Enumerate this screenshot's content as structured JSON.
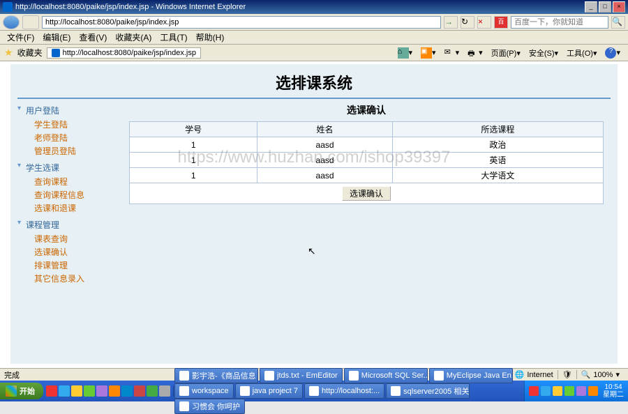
{
  "window": {
    "title": "http://localhost:8080/paike/jsp/index.jsp - Windows Internet Explorer",
    "min": "_",
    "max": "□",
    "close": "×"
  },
  "address": {
    "url": "http://localhost:8080/paike/jsp/index.jsp",
    "search_placeholder": "百度一下，你就知道"
  },
  "menu": {
    "file": "文件(F)",
    "edit": "编辑(E)",
    "view": "查看(V)",
    "favorites": "收藏夹(A)",
    "tools": "工具(T)",
    "help": "帮助(H)"
  },
  "favbar": {
    "label": "收藏夹",
    "tab": "http://localhost:8080/paike/jsp/index.jsp"
  },
  "cmdbar": {
    "page": "页面(P)",
    "safety": "安全(S)",
    "tools": "工具(O)"
  },
  "page": {
    "title": "选排课系统",
    "watermark": "https://www.huzhan.com/ishop39397",
    "panel_title": "选课确认",
    "confirm_btn": "选课确认"
  },
  "sidebar": {
    "groups": [
      {
        "title": "用户登陆",
        "items": [
          "学生登陆",
          "老师登陆",
          "管理员登陆"
        ]
      },
      {
        "title": "学生选课",
        "items": [
          "查询课程",
          "查询课程信息",
          "选课和退课"
        ]
      },
      {
        "title": "课程管理",
        "items": [
          "课表查询",
          "选课确认",
          "排课管理",
          "其它信息录入"
        ]
      }
    ]
  },
  "table": {
    "headers": [
      "学号",
      "姓名",
      "所选课程"
    ],
    "rows": [
      [
        "1",
        "aasd",
        "政治"
      ],
      [
        "1",
        "aasd",
        "英语"
      ],
      [
        "1",
        "aasd",
        "大学语文"
      ]
    ]
  },
  "status": {
    "done": "完成",
    "zone": "Internet",
    "zoom": "100%"
  },
  "taskbar": {
    "start": "开始",
    "tasks": [
      "影宇浩-《商品信息",
      "jtds.txt - EmEditor",
      "Microsoft SQL Ser...",
      "MyEclipse Java En...",
      "workspace",
      "java project 7",
      "http://localhost:...",
      "sqlserver2005 相关",
      "习惯会 你呵护"
    ],
    "time": "10:54",
    "date": "星期二"
  }
}
